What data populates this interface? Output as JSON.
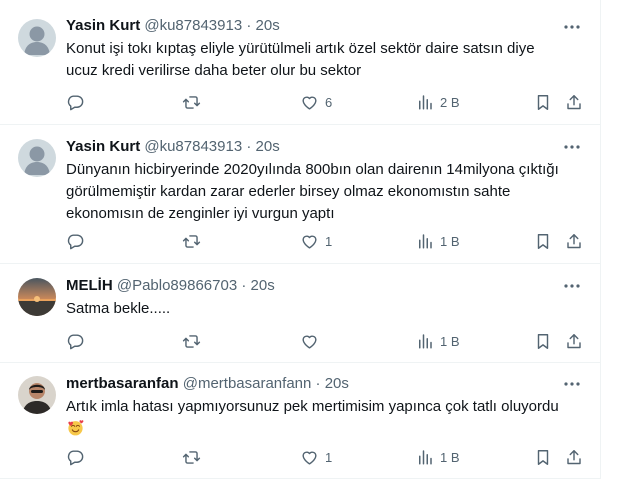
{
  "tweets": [
    {
      "name": "Yasin Kurt",
      "handle": "@ku87843913",
      "dot": "·",
      "time": "20s",
      "text": "Konut işi tokı kıptaş eliyle yürütülmeli artık özel sektör daire satsın diye ucuz kredi verilirse daha beter olur bu sektor",
      "likes": "6",
      "views": "2 B"
    },
    {
      "name": "Yasin Kurt",
      "handle": "@ku87843913",
      "dot": "·",
      "time": "20s",
      "text": "Dünyanın hicbiryerinde 2020yılında 800bın olan dairenın 14milyona çıktığı görülmemiştir kardan zarar ederler birsey olmaz ekonomıstın sahte ekonomısın de zenginler iyi vurgun yaptı",
      "likes": "1",
      "views": "1 B"
    },
    {
      "name": "MELİH",
      "handle": "@Pablo89866703",
      "dot": "·",
      "time": "20s",
      "text": "Satma bekle.....",
      "likes": "",
      "views": "1 B"
    },
    {
      "name": "mertbasaranfan",
      "handle": "@mertbasaranfann",
      "dot": "·",
      "time": "20s",
      "text": "Artık imla hatası yapmıyorsunuz pek mertimisim yapınca çok tatlı oluyordu",
      "likes": "1",
      "views": "1 B"
    }
  ],
  "colors": {
    "text": "#0f1419",
    "muted": "#536471",
    "divider": "#eff3f4",
    "default_avatar": "#cfd9de"
  },
  "icons": {
    "reply": "reply-icon",
    "retweet": "retweet-icon",
    "like": "heart-icon",
    "views": "views-bar-chart-icon",
    "bookmark": "bookmark-icon",
    "share": "share-icon",
    "more": "more-dots-icon"
  }
}
